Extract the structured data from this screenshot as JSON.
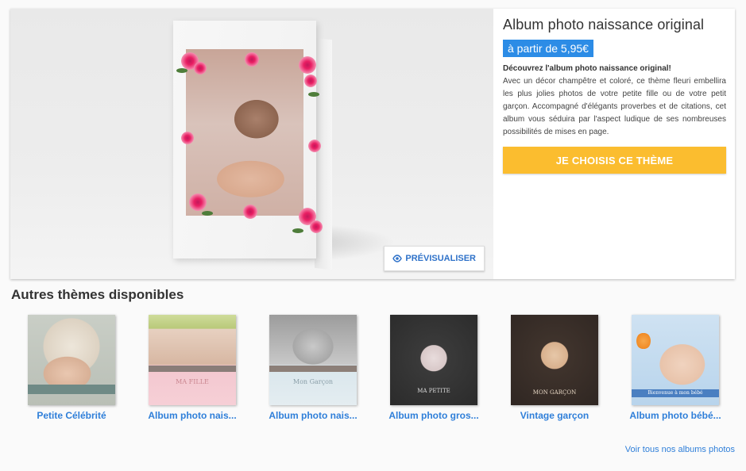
{
  "product": {
    "title": "Album photo naissance original",
    "price": "à partir de 5,95€",
    "description_title": "Découvrez l'album photo naissance original!",
    "description": "Avec un décor champêtre et coloré, ce thème fleuri embellira les plus jolies photos de votre petite fille ou de votre petit garçon. Accompagné d'élégants proverbes et de citations, cet album vous séduira par l'aspect ludique de ses nombreuses possibilités de mises en page.",
    "cta_label": "JE CHOISIS CE THÈME",
    "preview_label": "PRÉVISUALISER",
    "preview_icon": "eye-icon"
  },
  "other_themes": {
    "title": "Autres thèmes disponibles",
    "items": [
      {
        "label": "Petite Célébrité",
        "cover_caption": ""
      },
      {
        "label": "Album photo nais...",
        "cover_caption": "MA FILLE"
      },
      {
        "label": "Album photo nais...",
        "cover_caption": "Mon Garçon"
      },
      {
        "label": "Album photo gros...",
        "cover_caption": "MA PETITE"
      },
      {
        "label": "Vintage garçon",
        "cover_caption": "MON GARÇON"
      },
      {
        "label": "Album photo bébé...",
        "cover_caption": "Bienvenue à mon bébé"
      }
    ],
    "see_all": "Voir tous nos albums photos"
  },
  "colors": {
    "accent_blue": "#2c8ce6",
    "link_blue": "#2f7fd9",
    "cta_yellow": "#fbbd2f"
  }
}
